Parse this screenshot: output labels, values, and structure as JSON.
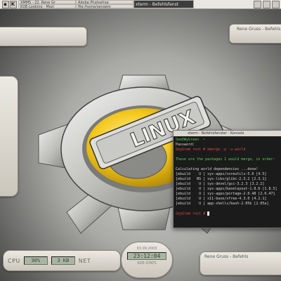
{
  "taskbar": {
    "logo_letter": "K",
    "tasks_top": [
      "XMMS - 22. Rene Gr",
      "Adobe Photoshop"
    ],
    "tasks_bottom": [
      "KDE-Looking - Mozi",
      "file:/home/seygem"
    ],
    "active_task": "xterm - Befehlsfenst"
  },
  "panels": {
    "right_top_title": "Rene Gruss - Befehls",
    "bottom_left": {
      "cpu_label": "CPU",
      "cpu_value": "30%",
      "net_value": "3 KB",
      "net_label": "NET"
    },
    "clock": {
      "date": "03.09.2003",
      "time": "23:12:04",
      "sub": "KDE-STATS"
    },
    "bottom_right": {
      "line1": "Rene Gruss - Befehls"
    }
  },
  "gear_badge": "LINUX",
  "xterm": {
    "title": "xterm - Befehlsfenster - Konsole",
    "lines": [
      {
        "cls": "g",
        "text": "SeeDWyGreen  ~ "
      },
      {
        "cls": "",
        "text": "Password:"
      },
      {
        "cls": "r",
        "text": "SeyGrem root # emerge -p -u world"
      },
      {
        "cls": "",
        "text": ""
      },
      {
        "cls": "g",
        "text": "These are the packages I would merge, in order:"
      },
      {
        "cls": "",
        "text": ""
      },
      {
        "cls": "",
        "text": "Calculating world dependencies ...done!"
      },
      {
        "cls": "",
        "text": "[ebuild    U ] sys-apps/coreutils-5.0 [4.5]"
      },
      {
        "cls": "",
        "text": "[ebuild   NS ] sys-libs/glibc-2.3.2 [2.3.1]"
      },
      {
        "cls": "",
        "text": "[ebuild    U ] sys-devel/gcc-3.2.3 [3.2.2]"
      },
      {
        "cls": "",
        "text": "[ebuild    U ] sys-apps/baselayout-1.8.6 [1.8.5]"
      },
      {
        "cls": "",
        "text": "[ebuild    U ] sys-apps/portage-2.0.48 [2.0.47]"
      },
      {
        "cls": "",
        "text": "[ebuild    U ] x11-base/xfree-4.3.0 [4.2.1]"
      },
      {
        "cls": "",
        "text": "[ebuild    U ] app-shells/bash-2.05b [2.05a]"
      },
      {
        "cls": "",
        "text": ""
      },
      {
        "cls": "r",
        "text": "SeyGrem root # "
      }
    ]
  }
}
